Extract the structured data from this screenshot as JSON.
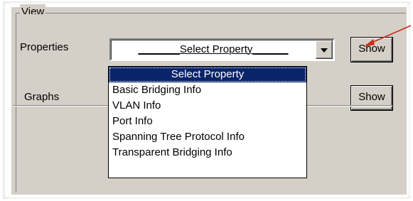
{
  "group": {
    "title": "View"
  },
  "properties": {
    "label": "Properties",
    "combo_value_pre": "_______",
    "combo_value": "Select Property",
    "combo_value_post": "______",
    "show_label": "Show"
  },
  "graphs": {
    "label": "Graphs",
    "show_label": "Show"
  },
  "dropdown": {
    "items": [
      "Select Property",
      "Basic Bridging Info",
      "VLAN Info",
      "Port Info",
      "Spanning Tree Protocol Info",
      "Transparent Bridging Info"
    ],
    "selected_index": 0
  },
  "colors": {
    "panel": "#d4d0c8",
    "selection": "#0a246a",
    "annotation_arrow": "#cc2b1b"
  }
}
